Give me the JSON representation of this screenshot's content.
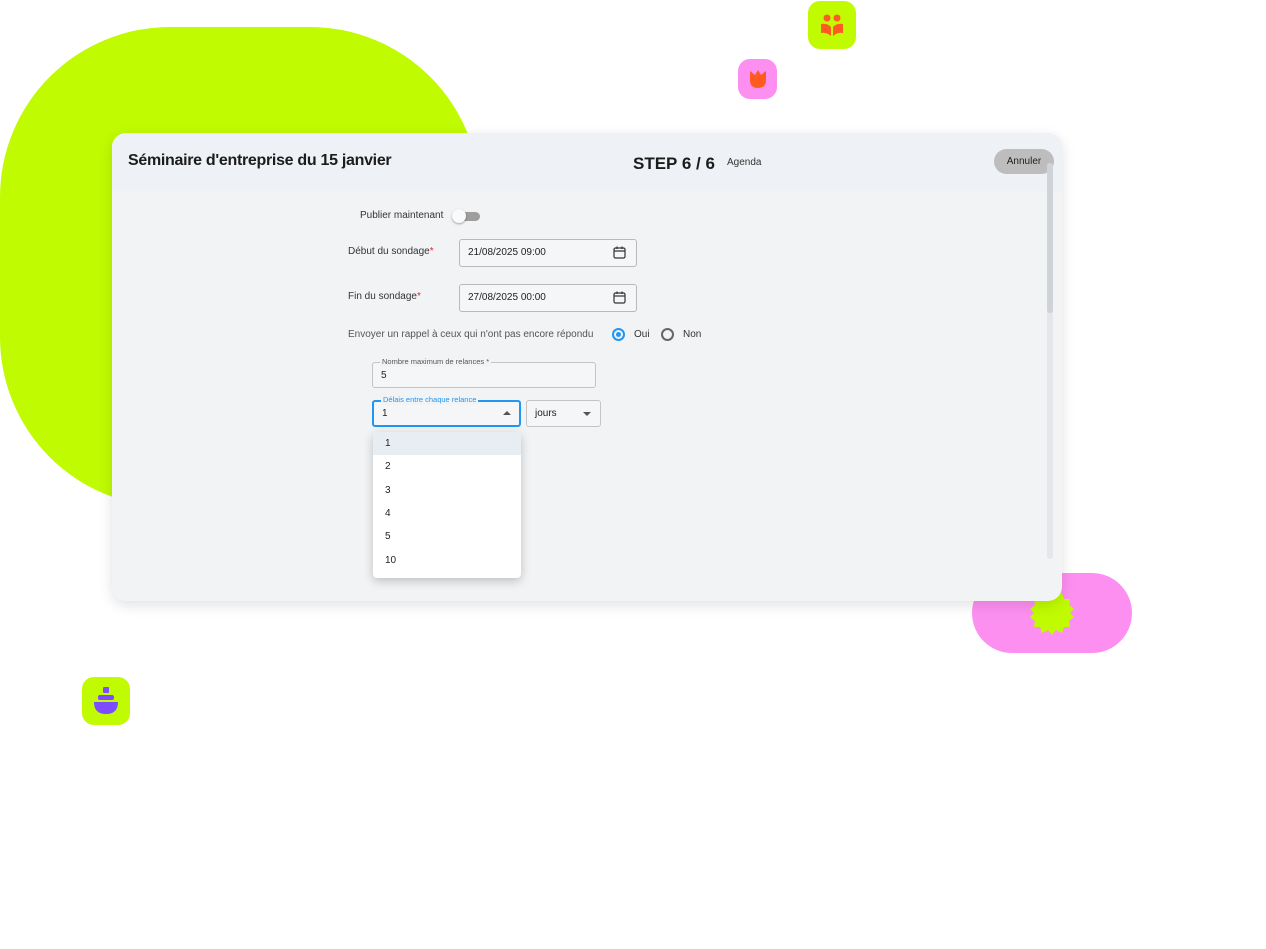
{
  "header": {
    "title": "Séminaire d'entreprise du 15 janvier",
    "step": "STEP 6 / 6",
    "step_name": "Agenda",
    "cancel_label": "Annuler"
  },
  "form": {
    "publish_now_label": "Publier maintenant",
    "publish_now_on": false,
    "start_label": "Début du sondage",
    "start_value": "21/08/2025 09:00",
    "end_label": "Fin du sondage",
    "end_value": "27/08/2025 00:00",
    "required_mark": "*",
    "reminder_question": "Envoyer un rappel à ceux qui n'ont pas encore répondu",
    "reminder_yes": "Oui",
    "reminder_no": "Non",
    "reminder_selected": "Oui",
    "max_reminders_label": "Nombre maximum de relances *",
    "max_reminders_value": "5",
    "delay_label": "Délais entre chaque relance",
    "delay_value": "1",
    "delay_unit": "jours",
    "delay_options": [
      "1",
      "2",
      "3",
      "4",
      "5",
      "10"
    ]
  },
  "colors": {
    "accent": "#2196f3",
    "lime": "#c0fb02",
    "pink": "#fd8ff1",
    "orange": "#ff5a1f",
    "purple": "#7b4dff",
    "required": "#d32f2f"
  }
}
